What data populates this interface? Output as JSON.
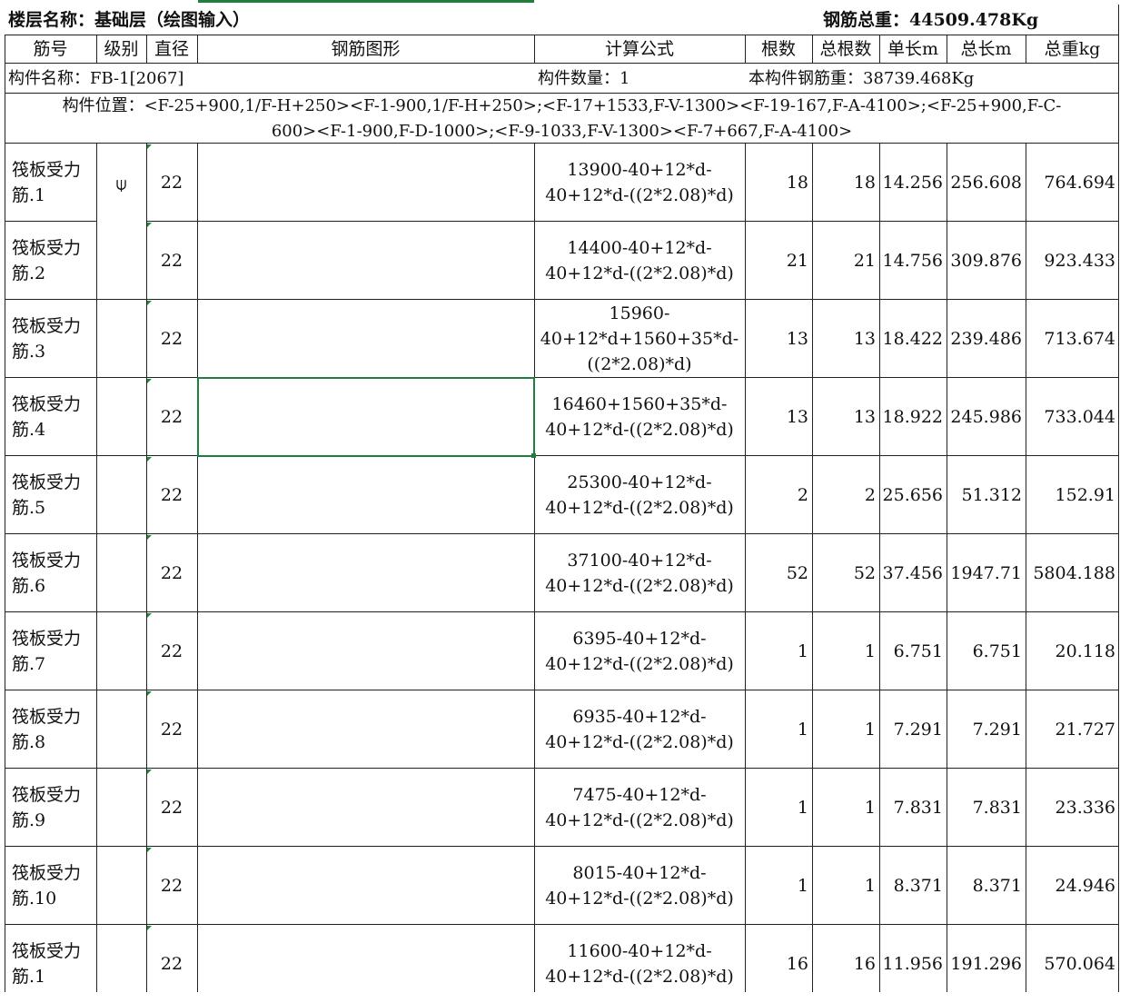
{
  "sheet": {
    "floor_title": "楼层名称：基础层（绘图输入）",
    "total_weight": "钢筋总重：44509.478Kg"
  },
  "headers": {
    "bar_no": "筋号",
    "grade": "级别",
    "diameter": "直径",
    "shape": "钢筋图形",
    "formula": "计算公式",
    "count": "根数",
    "total_count": "总根数",
    "unit_length": "单长m",
    "total_length": "总长m",
    "total_weight": "总重kg"
  },
  "member": {
    "name": "构件名称：FB-1[2067]",
    "quantity": "构件数量：1",
    "weight": "本构件钢筋重：38739.468Kg",
    "position_line1": "构件位置：<F-25+900,1/F-H+250><F-1-900,1/F-H+250>;<F-17+1533,F-V-1300><F-19-167,F-A-4100>;<F-25+900,F-C-",
    "position_line2": "600><F-1-900,F-D-1000>;<F-9-1033,F-V-1300><F-7+667,F-A-4100>"
  },
  "grade_symbol": "⍦",
  "rows": [
    {
      "name1": "筏板受力",
      "name2": "筋.1",
      "dia": "22",
      "f1": "13900-40+12*d-",
      "f2": "40+12*d-((2*2.08)*d)",
      "f3": "",
      "count": "18",
      "total": "18",
      "unit": "14.256",
      "tlen": "256.608",
      "weight": "764.694"
    },
    {
      "name1": "筏板受力",
      "name2": "筋.2",
      "dia": "22",
      "f1": "14400-40+12*d-",
      "f2": "40+12*d-((2*2.08)*d)",
      "f3": "",
      "count": "21",
      "total": "21",
      "unit": "14.756",
      "tlen": "309.876",
      "weight": "923.433"
    },
    {
      "name1": "筏板受力",
      "name2": "筋.3",
      "dia": "22",
      "f1": "15960-",
      "f2": "40+12*d+1560+35*d-",
      "f3": "((2*2.08)*d)",
      "count": "13",
      "total": "13",
      "unit": "18.422",
      "tlen": "239.486",
      "weight": "713.674"
    },
    {
      "name1": "筏板受力",
      "name2": "筋.4",
      "dia": "22",
      "f1": "16460+1560+35*d-",
      "f2": "40+12*d-((2*2.08)*d)",
      "f3": "",
      "count": "13",
      "total": "13",
      "unit": "18.922",
      "tlen": "245.986",
      "weight": "733.044"
    },
    {
      "name1": "筏板受力",
      "name2": "筋.5",
      "dia": "22",
      "f1": "25300-40+12*d-",
      "f2": "40+12*d-((2*2.08)*d)",
      "f3": "",
      "count": "2",
      "total": "2",
      "unit": "25.656",
      "tlen": "51.312",
      "weight": "152.91"
    },
    {
      "name1": "筏板受力",
      "name2": "筋.6",
      "dia": "22",
      "f1": "37100-40+12*d-",
      "f2": "40+12*d-((2*2.08)*d)",
      "f3": "",
      "count": "52",
      "total": "52",
      "unit": "37.456",
      "tlen": "1947.71",
      "weight": "5804.188"
    },
    {
      "name1": "筏板受力",
      "name2": "筋.7",
      "dia": "22",
      "f1": "6395-40+12*d-",
      "f2": "40+12*d-((2*2.08)*d)",
      "f3": "",
      "count": "1",
      "total": "1",
      "unit": "6.751",
      "tlen": "6.751",
      "weight": "20.118"
    },
    {
      "name1": "筏板受力",
      "name2": "筋.8",
      "dia": "22",
      "f1": "6935-40+12*d-",
      "f2": "40+12*d-((2*2.08)*d)",
      "f3": "",
      "count": "1",
      "total": "1",
      "unit": "7.291",
      "tlen": "7.291",
      "weight": "21.727"
    },
    {
      "name1": "筏板受力",
      "name2": "筋.9",
      "dia": "22",
      "f1": "7475-40+12*d-",
      "f2": "40+12*d-((2*2.08)*d)",
      "f3": "",
      "count": "1",
      "total": "1",
      "unit": "7.831",
      "tlen": "7.831",
      "weight": "23.336"
    },
    {
      "name1": "筏板受力",
      "name2": "筋.10",
      "dia": "22",
      "f1": "8015-40+12*d-",
      "f2": "40+12*d-((2*2.08)*d)",
      "f3": "",
      "count": "1",
      "total": "1",
      "unit": "8.371",
      "tlen": "8.371",
      "weight": "24.946"
    },
    {
      "name1": "筏板受力",
      "name2": "筋.1",
      "dia": "22",
      "f1": "11600-40+12*d-",
      "f2": "40+12*d-((2*2.08)*d)",
      "f3": "",
      "count": "16",
      "total": "16",
      "unit": "11.956",
      "tlen": "191.296",
      "weight": "570.064"
    }
  ]
}
